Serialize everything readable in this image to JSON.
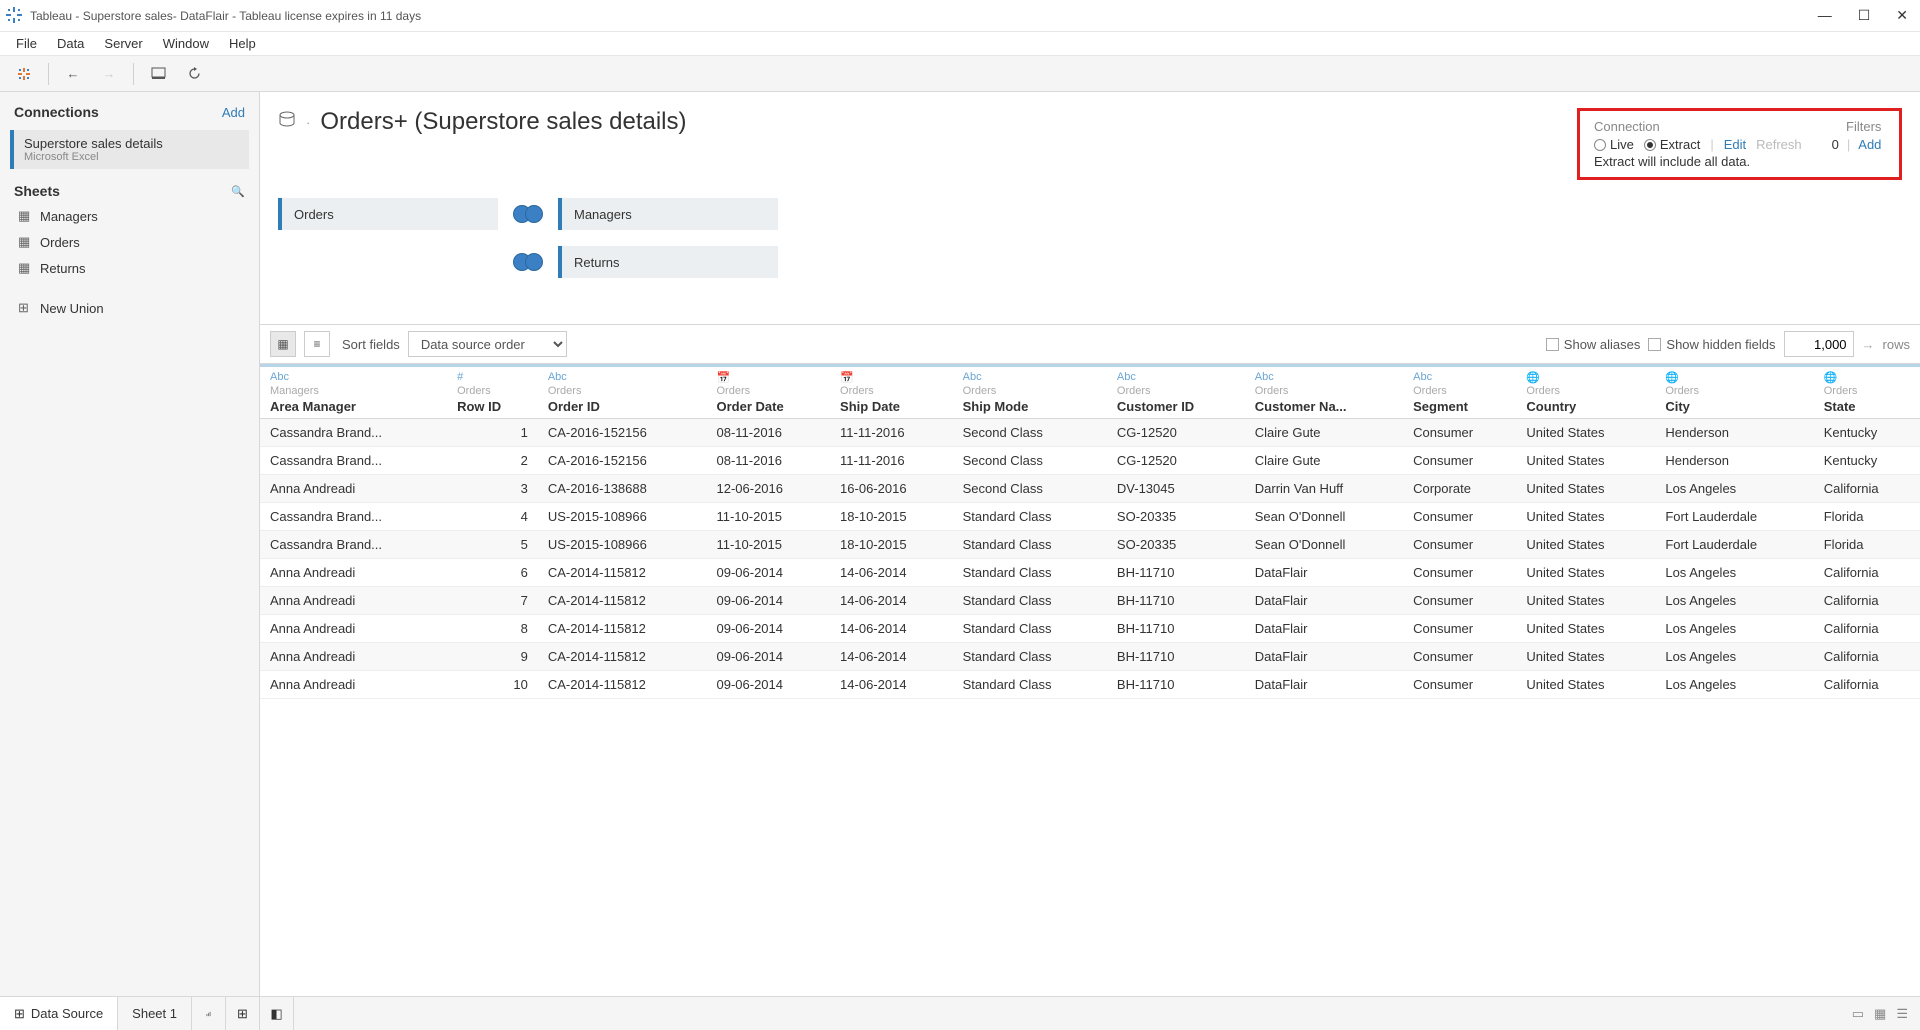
{
  "window": {
    "title": "Tableau - Superstore sales- DataFlair - Tableau license expires in 11 days"
  },
  "menu": [
    "File",
    "Data",
    "Server",
    "Window",
    "Help"
  ],
  "sidebar": {
    "connections": {
      "title": "Connections",
      "add": "Add",
      "items": [
        {
          "name": "Superstore sales details",
          "sub": "Microsoft Excel"
        }
      ]
    },
    "sheets": {
      "title": "Sheets",
      "items": [
        "Managers",
        "Orders",
        "Returns"
      ],
      "new_union": "New Union"
    }
  },
  "datasource": {
    "title": "Orders+ (Superstore sales details)",
    "tables": {
      "root": "Orders",
      "joins": [
        "Managers",
        "Returns"
      ]
    }
  },
  "connection_panel": {
    "label": "Connection",
    "live": "Live",
    "extract": "Extract",
    "selected": "extract",
    "edit": "Edit",
    "refresh": "Refresh",
    "note": "Extract will include all data.",
    "filters_label": "Filters",
    "filters_count": "0",
    "filters_add": "Add"
  },
  "grid_toolbar": {
    "sort_label": "Sort fields",
    "sort_value": "Data source order",
    "show_aliases": "Show aliases",
    "show_hidden": "Show hidden fields",
    "rows_value": "1,000",
    "rows_arrow": "→",
    "rows_label": "rows"
  },
  "grid": {
    "columns": [
      {
        "type": "Abc",
        "src": "Managers",
        "name": "Area Manager",
        "kind": "text"
      },
      {
        "type": "#",
        "src": "Orders",
        "name": "Row ID",
        "kind": "num"
      },
      {
        "type": "Abc",
        "src": "Orders",
        "name": "Order ID",
        "kind": "text"
      },
      {
        "type": "date",
        "src": "Orders",
        "name": "Order Date",
        "kind": "text"
      },
      {
        "type": "date",
        "src": "Orders",
        "name": "Ship Date",
        "kind": "text"
      },
      {
        "type": "Abc",
        "src": "Orders",
        "name": "Ship Mode",
        "kind": "text"
      },
      {
        "type": "Abc",
        "src": "Orders",
        "name": "Customer ID",
        "kind": "text"
      },
      {
        "type": "Abc",
        "src": "Orders",
        "name": "Customer Na...",
        "kind": "text"
      },
      {
        "type": "Abc",
        "src": "Orders",
        "name": "Segment",
        "kind": "text"
      },
      {
        "type": "geo",
        "src": "Orders",
        "name": "Country",
        "kind": "text"
      },
      {
        "type": "geo",
        "src": "Orders",
        "name": "City",
        "kind": "text"
      },
      {
        "type": "geo",
        "src": "Orders",
        "name": "State",
        "kind": "text"
      }
    ],
    "rows": [
      [
        "Cassandra Brand...",
        "1",
        "CA-2016-152156",
        "08-11-2016",
        "11-11-2016",
        "Second Class",
        "CG-12520",
        "Claire Gute",
        "Consumer",
        "United States",
        "Henderson",
        "Kentucky"
      ],
      [
        "Cassandra Brand...",
        "2",
        "CA-2016-152156",
        "08-11-2016",
        "11-11-2016",
        "Second Class",
        "CG-12520",
        "Claire Gute",
        "Consumer",
        "United States",
        "Henderson",
        "Kentucky"
      ],
      [
        "Anna Andreadi",
        "3",
        "CA-2016-138688",
        "12-06-2016",
        "16-06-2016",
        "Second Class",
        "DV-13045",
        "Darrin Van Huff",
        "Corporate",
        "United States",
        "Los Angeles",
        "California"
      ],
      [
        "Cassandra Brand...",
        "4",
        "US-2015-108966",
        "11-10-2015",
        "18-10-2015",
        "Standard Class",
        "SO-20335",
        "Sean O'Donnell",
        "Consumer",
        "United States",
        "Fort Lauderdale",
        "Florida"
      ],
      [
        "Cassandra Brand...",
        "5",
        "US-2015-108966",
        "11-10-2015",
        "18-10-2015",
        "Standard Class",
        "SO-20335",
        "Sean O'Donnell",
        "Consumer",
        "United States",
        "Fort Lauderdale",
        "Florida"
      ],
      [
        "Anna Andreadi",
        "6",
        "CA-2014-115812",
        "09-06-2014",
        "14-06-2014",
        "Standard Class",
        "BH-11710",
        "DataFlair",
        "Consumer",
        "United States",
        "Los Angeles",
        "California"
      ],
      [
        "Anna Andreadi",
        "7",
        "CA-2014-115812",
        "09-06-2014",
        "14-06-2014",
        "Standard Class",
        "BH-11710",
        "DataFlair",
        "Consumer",
        "United States",
        "Los Angeles",
        "California"
      ],
      [
        "Anna Andreadi",
        "8",
        "CA-2014-115812",
        "09-06-2014",
        "14-06-2014",
        "Standard Class",
        "BH-11710",
        "DataFlair",
        "Consumer",
        "United States",
        "Los Angeles",
        "California"
      ],
      [
        "Anna Andreadi",
        "9",
        "CA-2014-115812",
        "09-06-2014",
        "14-06-2014",
        "Standard Class",
        "BH-11710",
        "DataFlair",
        "Consumer",
        "United States",
        "Los Angeles",
        "California"
      ],
      [
        "Anna Andreadi",
        "10",
        "CA-2014-115812",
        "09-06-2014",
        "14-06-2014",
        "Standard Class",
        "BH-11710",
        "DataFlair",
        "Consumer",
        "United States",
        "Los Angeles",
        "California"
      ]
    ]
  },
  "bottom": {
    "data_source": "Data Source",
    "sheet": "Sheet 1"
  }
}
